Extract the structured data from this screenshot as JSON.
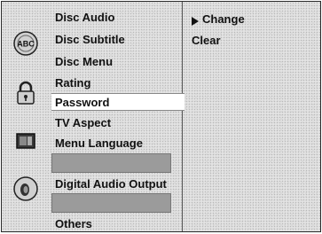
{
  "menu": {
    "disc_audio": "Disc Audio",
    "disc_subtitle": "Disc Subtitle",
    "disc_menu": "Disc Menu",
    "rating": "Rating",
    "password": "Password",
    "tv_aspect": "TV Aspect",
    "menu_language": "Menu Language",
    "digital_audio_output": "Digital Audio Output",
    "others": "Others"
  },
  "submenu": {
    "change": "Change",
    "clear": "Clear"
  },
  "icons": {
    "disc_settings": "abc-disc-icon",
    "lock": "padlock-icon",
    "display": "tv-screen-icon",
    "audio": "speaker-icon"
  }
}
